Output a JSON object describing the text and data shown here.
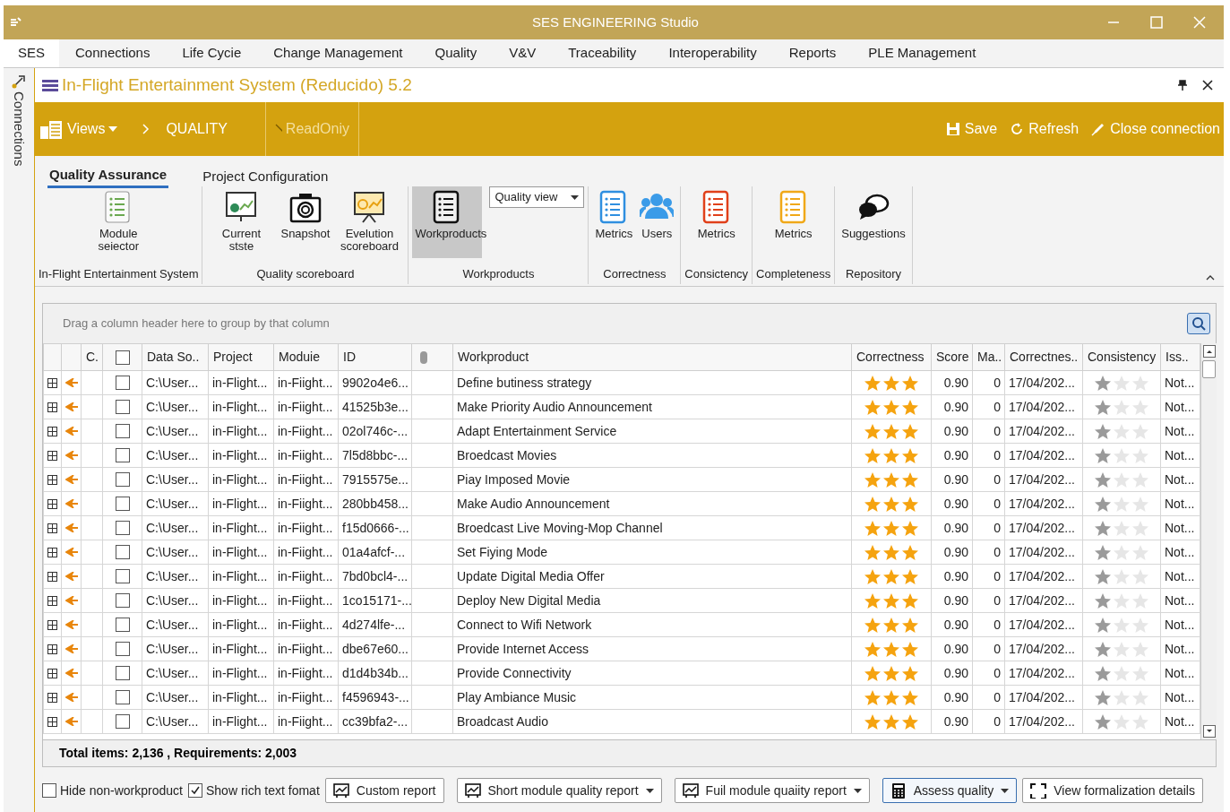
{
  "window": {
    "title": "SES ENGINEERING Studio"
  },
  "menu": [
    {
      "label": "SES",
      "selected": true
    },
    {
      "label": "Connections",
      "selected": false
    },
    {
      "label": "Life Cycie",
      "selected": false
    },
    {
      "label": "Change Management",
      "selected": false
    },
    {
      "label": "Quality",
      "selected": false
    },
    {
      "label": "V&V",
      "selected": false
    },
    {
      "label": "Traceability",
      "selected": false
    },
    {
      "label": "Interoperability",
      "selected": false
    },
    {
      "label": "Reports",
      "selected": false
    },
    {
      "label": "PLE Management",
      "selected": false
    }
  ],
  "side_panel": {
    "label": "Connections"
  },
  "document": {
    "title": "In-Flight Entertainment System (Reducido) 5.2"
  },
  "toolbar": {
    "views": "Views",
    "breadcrumb": "QUALITY",
    "mode": "ReadOniy",
    "actions": [
      {
        "kind": "save",
        "label": "Save"
      },
      {
        "kind": "refresh",
        "label": "Refresh"
      },
      {
        "kind": "close",
        "label": "Close connection"
      }
    ]
  },
  "ribbon_tabs": [
    {
      "label": "Quality Assurance",
      "selected": true
    },
    {
      "label": "Project Configuration",
      "selected": false
    }
  ],
  "ribbon_groups": [
    {
      "label": "In-Flight Entertainment System",
      "buttons": [
        {
          "kind": "list",
          "label": "Module seiector",
          "selected": false
        }
      ]
    },
    {
      "label": "Quality scoreboard",
      "buttons": [
        {
          "kind": "board",
          "label": "Current stste",
          "selected": false
        },
        {
          "kind": "camera",
          "label": "Snapshot",
          "selected": false
        },
        {
          "kind": "easel",
          "label": "Evelution scoreboard",
          "selected": false
        }
      ]
    },
    {
      "label": "Workproducts",
      "buttons": [
        {
          "kind": "listdark",
          "label": "Workproducts",
          "selected": true
        }
      ],
      "dropdown": "Quality view"
    },
    {
      "label": "Correctness",
      "buttons": [
        {
          "kind": "listblue",
          "label": "Metrics",
          "selected": false
        },
        {
          "kind": "users",
          "label": "Users",
          "selected": false
        }
      ]
    },
    {
      "label": "Consictency",
      "buttons": [
        {
          "kind": "listred",
          "label": "Metrics",
          "selected": false
        }
      ]
    },
    {
      "label": "Completeness",
      "buttons": [
        {
          "kind": "listorange",
          "label": "Metrics",
          "selected": false
        }
      ]
    },
    {
      "label": "Repository",
      "buttons": [
        {
          "kind": "chat",
          "label": "Suggestions",
          "selected": false
        }
      ]
    }
  ],
  "grid": {
    "group_hint": "Drag a column header here to group by that column",
    "columns": [
      "C.",
      "Data So..",
      "Project",
      "Moduie",
      "ID",
      "Workproduct",
      "Correctness",
      "Score",
      "Ma..",
      "Correctnes..",
      "Consistency",
      "Iss.."
    ],
    "select_all_checked": false,
    "rows": [
      {
        "checked": false,
        "data_source": "C:\\User...",
        "project": "in-Flight...",
        "module": "in-Fiight...",
        "id": "9902o4e6...",
        "workproduct": "Define butiness strategy",
        "correctness": {
          "stars": 3
        },
        "score": "0.90",
        "ma": "0",
        "date": "17/04/202...",
        "consistency": {
          "stars": 1
        },
        "issue": "Not..."
      },
      {
        "checked": false,
        "data_source": "C:\\User...",
        "project": "in-Flight...",
        "module": "in-Fiight...",
        "id": "41525b3e...",
        "workproduct": "Make Priority Audio Announcement",
        "correctness": {
          "stars": 3
        },
        "score": "0.90",
        "ma": "0",
        "date": "17/04/202...",
        "consistency": {
          "stars": 1
        },
        "issue": "Not..."
      },
      {
        "checked": false,
        "data_source": "C:\\User...",
        "project": "in-Flight...",
        "module": "in-Fiight...",
        "id": "02ol746c-...",
        "workproduct": "Adapt Entertainment Service",
        "correctness": {
          "stars": 3
        },
        "score": "0.90",
        "ma": "0",
        "date": "17/04/202...",
        "consistency": {
          "stars": 1
        },
        "issue": "Not..."
      },
      {
        "checked": false,
        "data_source": "C:\\User...",
        "project": "in-Flight...",
        "module": "in-Fiight...",
        "id": "7l5d8bbc-...",
        "workproduct": "Broedcast Movies",
        "correctness": {
          "stars": 3
        },
        "score": "0.90",
        "ma": "0",
        "date": "17/04/202...",
        "consistency": {
          "stars": 1
        },
        "issue": "Not..."
      },
      {
        "checked": false,
        "data_source": "C:\\User...",
        "project": "in-Flight...",
        "module": "in-Fiight...",
        "id": "7915575e...",
        "workproduct": "Piay Imposed Movie",
        "correctness": {
          "stars": 3
        },
        "score": "0.90",
        "ma": "0",
        "date": "17/04/202...",
        "consistency": {
          "stars": 1
        },
        "issue": "Not..."
      },
      {
        "checked": false,
        "data_source": "C:\\User...",
        "project": "in-Flight...",
        "module": "in-Fiight...",
        "id": "280bb458...",
        "workproduct": "Make Audio Announcement",
        "correctness": {
          "stars": 3
        },
        "score": "0.90",
        "ma": "0",
        "date": "17/04/202...",
        "consistency": {
          "stars": 1
        },
        "issue": "Not..."
      },
      {
        "checked": false,
        "data_source": "C:\\User...",
        "project": "in-Flight...",
        "module": "in-Fiight...",
        "id": "f15d0666-...",
        "workproduct": "Broedcast Live Moving-Mop Channel",
        "correctness": {
          "stars": 3
        },
        "score": "0.90",
        "ma": "0",
        "date": "17/04/202...",
        "consistency": {
          "stars": 1
        },
        "issue": "Not..."
      },
      {
        "checked": false,
        "data_source": "C:\\User...",
        "project": "in-Flight...",
        "module": "in-Fiight...",
        "id": "01a4afcf-...",
        "workproduct": "Set Fiying Mode",
        "correctness": {
          "stars": 3
        },
        "score": "0.90",
        "ma": "0",
        "date": "17/04/202...",
        "consistency": {
          "stars": 1
        },
        "issue": "Not..."
      },
      {
        "checked": false,
        "data_source": "C:\\User...",
        "project": "in-Flight...",
        "module": "in-Fiight...",
        "id": "7bd0bcl4-...",
        "workproduct": "Update Digital Media Offer",
        "correctness": {
          "stars": 3
        },
        "score": "0.90",
        "ma": "0",
        "date": "17/04/202...",
        "consistency": {
          "stars": 1
        },
        "issue": "Not..."
      },
      {
        "checked": false,
        "data_source": "C:\\User...",
        "project": "in-Flight...",
        "module": "in-Fiight...",
        "id": "1co15171-...",
        "workproduct": "Deploy New Digital Media",
        "correctness": {
          "stars": 3
        },
        "score": "0.90",
        "ma": "0",
        "date": "17/04/202...",
        "consistency": {
          "stars": 1
        },
        "issue": "Not..."
      },
      {
        "checked": false,
        "data_source": "C:\\User...",
        "project": "in-Flight...",
        "module": "in-Fiight...",
        "id": "4d274lfe-...",
        "workproduct": "Connect to Wifi Network",
        "correctness": {
          "stars": 3
        },
        "score": "0.90",
        "ma": "0",
        "date": "17/04/202...",
        "consistency": {
          "stars": 1
        },
        "issue": "Not..."
      },
      {
        "checked": false,
        "data_source": "C:\\User...",
        "project": "in-Flight...",
        "module": "in-Fiight...",
        "id": "dbe67e60...",
        "workproduct": "Provide Internet Access",
        "correctness": {
          "stars": 3
        },
        "score": "0.90",
        "ma": "0",
        "date": "17/04/202...",
        "consistency": {
          "stars": 1
        },
        "issue": "Not..."
      },
      {
        "checked": false,
        "data_source": "C:\\User...",
        "project": "in-Flight...",
        "module": "in-Fiight...",
        "id": "d1d4b34b...",
        "workproduct": "Provide Connectivity",
        "correctness": {
          "stars": 3
        },
        "score": "0.90",
        "ma": "0",
        "date": "17/04/202...",
        "consistency": {
          "stars": 1
        },
        "issue": "Not..."
      },
      {
        "checked": false,
        "data_source": "C:\\User...",
        "project": "in-Flight...",
        "module": "in-Fiight...",
        "id": "f4596943-...",
        "workproduct": "Play Ambiance Music",
        "correctness": {
          "stars": 3
        },
        "score": "0.90",
        "ma": "0",
        "date": "17/04/202...",
        "consistency": {
          "stars": 1
        },
        "issue": "Not..."
      },
      {
        "checked": false,
        "data_source": "C:\\User...",
        "project": "in-Flight...",
        "module": "in-Fiight...",
        "id": "cc39bfa2-...",
        "workproduct": "Broadcast Audio",
        "correctness": {
          "stars": 3
        },
        "score": "0.90",
        "ma": "0",
        "date": "17/04/202...",
        "consistency": {
          "stars": 1
        },
        "issue": "Not..."
      }
    ],
    "footer": "Total items: 2,136 , Requirements:  2,003"
  },
  "options": [
    {
      "label": "Hide non-workproduct",
      "checked": false
    },
    {
      "label": "Show rich text fomat",
      "checked": true
    }
  ],
  "buttons": [
    {
      "kind": "report",
      "label": "Custom report",
      "dropdown": false,
      "selected": false
    },
    {
      "kind": "report",
      "label": "Short module quality report",
      "dropdown": true,
      "selected": false
    },
    {
      "kind": "report",
      "label": "Fuil module quaiity report",
      "dropdown": true,
      "selected": false
    },
    {
      "kind": "calc",
      "label": "Assess quality",
      "dropdown": true,
      "selected": true
    },
    {
      "kind": "frame",
      "label": "View formalization details",
      "dropdown": false,
      "selected": false
    }
  ]
}
